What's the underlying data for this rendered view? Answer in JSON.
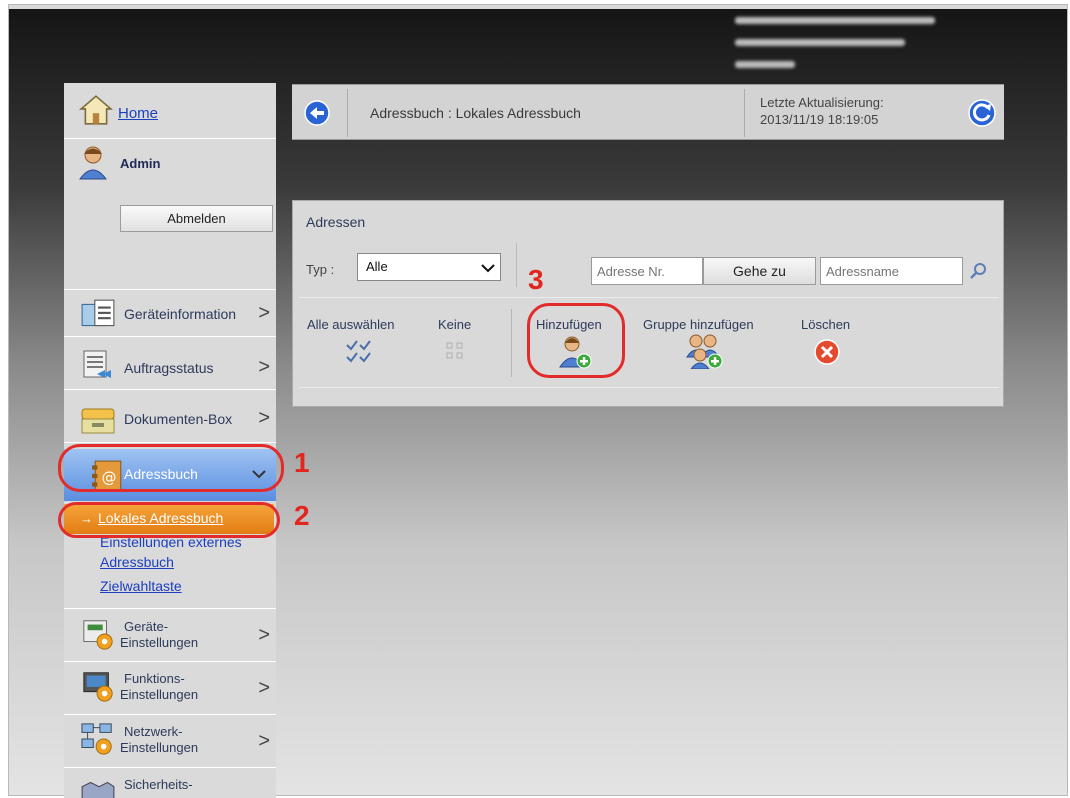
{
  "sidebar": {
    "home_label": "Home",
    "user_label": "Admin",
    "logout_label": "Abmelden",
    "items": [
      {
        "label": "Geräteinformation",
        "icon": "device-info-icon"
      },
      {
        "label": "Auftragsstatus",
        "icon": "job-status-icon"
      },
      {
        "label": "Dokumenten-Box",
        "icon": "document-box-icon"
      },
      {
        "label": "Adressbuch",
        "icon": "address-book-icon",
        "expanded": true
      }
    ],
    "subitems": {
      "active": "Lokales Adressbuch",
      "external_line1": "Einstellungen externes",
      "external_line2": "Adressbuch",
      "speed_dial": "Zielwahltaste"
    },
    "settings": [
      {
        "line1": "Geräte-",
        "line2": "Einstellungen"
      },
      {
        "line1": "Funktions-",
        "line2": "Einstellungen"
      },
      {
        "line1": "Netzwerk-",
        "line2": "Einstellungen"
      },
      {
        "line1": "Sicherheits-",
        "line2": ""
      }
    ],
    "chevron": ">"
  },
  "header": {
    "breadcrumb": "Adressbuch : Lokales Adressbuch",
    "last_update_label": "Letzte Aktualisierung:",
    "last_update_value": "2013/11/19 18:19:05"
  },
  "panel": {
    "title": "Adressen",
    "type_label": "Typ :",
    "type_value": "Alle",
    "number_placeholder": "Adresse Nr.",
    "goto_label": "Gehe zu",
    "name_placeholder": "Adressname",
    "actions": {
      "select_all": "Alle auswählen",
      "none": "Keine",
      "add": "Hinzufügen",
      "add_group": "Gruppe hinzufügen",
      "delete": "Löschen"
    }
  },
  "annotations": {
    "step1": "1",
    "step2": "2",
    "step3": "3"
  },
  "colors": {
    "annotation": "#e32b2b",
    "highlight_orange": "#f39a2e",
    "sidebar_bg": "#dadada",
    "link_blue": "#1b3fbf"
  }
}
